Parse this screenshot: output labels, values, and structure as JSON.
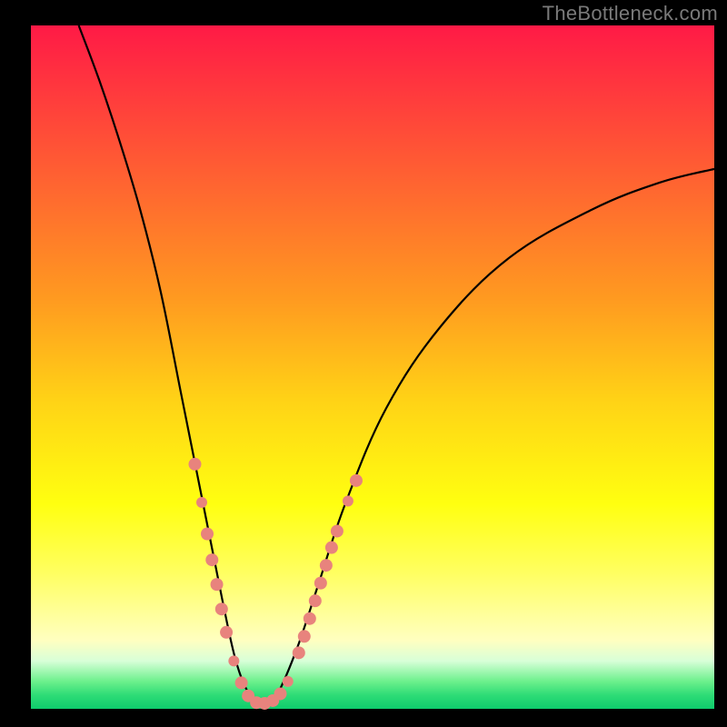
{
  "watermark": "TheBottleneck.com",
  "chart_data": {
    "type": "line",
    "title": "",
    "xlabel": "",
    "ylabel": "",
    "xlim": [
      0,
      100
    ],
    "ylim": [
      0,
      100
    ],
    "curve": {
      "description": "V-shaped bottleneck curve; minimum near x≈33",
      "left_branch": [
        {
          "x": 7,
          "y": 100
        },
        {
          "x": 10,
          "y": 92
        },
        {
          "x": 13,
          "y": 83
        },
        {
          "x": 16,
          "y": 73
        },
        {
          "x": 19,
          "y": 61
        },
        {
          "x": 22,
          "y": 46
        },
        {
          "x": 25,
          "y": 31
        },
        {
          "x": 28,
          "y": 16
        },
        {
          "x": 30,
          "y": 7
        },
        {
          "x": 32,
          "y": 2
        },
        {
          "x": 34,
          "y": 0
        }
      ],
      "right_branch": [
        {
          "x": 34,
          "y": 0
        },
        {
          "x": 36,
          "y": 2
        },
        {
          "x": 39,
          "y": 9
        },
        {
          "x": 42,
          "y": 18
        },
        {
          "x": 46,
          "y": 30
        },
        {
          "x": 52,
          "y": 44
        },
        {
          "x": 60,
          "y": 56
        },
        {
          "x": 70,
          "y": 66
        },
        {
          "x": 82,
          "y": 73
        },
        {
          "x": 92,
          "y": 77
        },
        {
          "x": 100,
          "y": 79
        }
      ]
    },
    "beads": [
      {
        "x": 24.0,
        "y": 35.8,
        "r": 7
      },
      {
        "x": 25.0,
        "y": 30.2,
        "r": 6
      },
      {
        "x": 25.8,
        "y": 25.6,
        "r": 7
      },
      {
        "x": 26.5,
        "y": 21.8,
        "r": 7
      },
      {
        "x": 27.2,
        "y": 18.2,
        "r": 7
      },
      {
        "x": 27.9,
        "y": 14.6,
        "r": 7
      },
      {
        "x": 28.6,
        "y": 11.2,
        "r": 7
      },
      {
        "x": 29.7,
        "y": 7.0,
        "r": 6
      },
      {
        "x": 30.8,
        "y": 3.8,
        "r": 7
      },
      {
        "x": 31.8,
        "y": 1.9,
        "r": 7
      },
      {
        "x": 33.0,
        "y": 0.9,
        "r": 7
      },
      {
        "x": 34.2,
        "y": 0.8,
        "r": 7
      },
      {
        "x": 35.4,
        "y": 1.2,
        "r": 7
      },
      {
        "x": 36.5,
        "y": 2.2,
        "r": 7
      },
      {
        "x": 37.6,
        "y": 4.0,
        "r": 6
      },
      {
        "x": 39.2,
        "y": 8.2,
        "r": 7
      },
      {
        "x": 40.0,
        "y": 10.6,
        "r": 7
      },
      {
        "x": 40.8,
        "y": 13.2,
        "r": 7
      },
      {
        "x": 41.6,
        "y": 15.8,
        "r": 7
      },
      {
        "x": 42.4,
        "y": 18.4,
        "r": 7
      },
      {
        "x": 43.2,
        "y": 21.0,
        "r": 7
      },
      {
        "x": 44.0,
        "y": 23.6,
        "r": 7
      },
      {
        "x": 44.8,
        "y": 26.0,
        "r": 7
      },
      {
        "x": 46.4,
        "y": 30.4,
        "r": 6
      },
      {
        "x": 47.6,
        "y": 33.4,
        "r": 7
      }
    ]
  }
}
